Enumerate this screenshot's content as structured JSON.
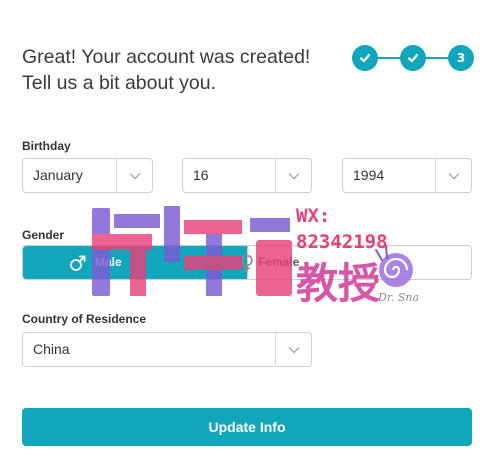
{
  "headline": "Great! Your account was created! Tell us a bit about you.",
  "steps": {
    "step3_label": "3",
    "completed": 2,
    "current": 3
  },
  "birthday": {
    "label": "Birthday",
    "month": "January",
    "day": "16",
    "year": "1994"
  },
  "gender": {
    "label": "Gender",
    "options": [
      "Male",
      "Female"
    ],
    "selected": "Male"
  },
  "country": {
    "label": "Country of Residence",
    "value": "China"
  },
  "submit_label": "Update Info",
  "watermark": {
    "line1": "WX:",
    "line2": "82342198",
    "line3": "教授",
    "signature": "Dr. Snail"
  },
  "colors": {
    "accent": "#12a6bd",
    "watermark_pink": "#e8407a",
    "watermark_purple": "#7b5bd6"
  }
}
